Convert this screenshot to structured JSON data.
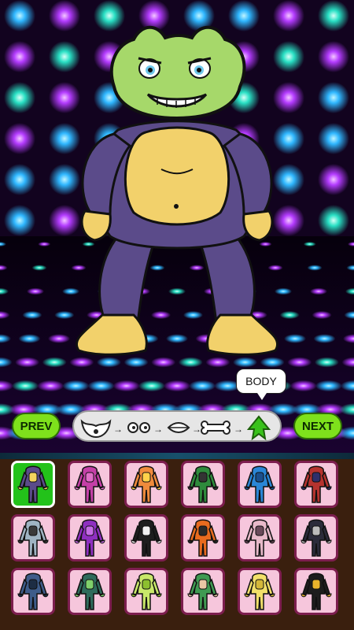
{
  "tooltip": {
    "label": "BODY"
  },
  "nav": {
    "prev_label": "PREV",
    "next_label": "NEXT"
  },
  "steps": [
    {
      "name": "head-shape-step-icon"
    },
    {
      "name": "eyes-step-icon"
    },
    {
      "name": "mouth-step-icon"
    },
    {
      "name": "bone-step-icon"
    },
    {
      "name": "body-step-icon",
      "active": true
    }
  ],
  "body_options": [
    {
      "name": "body-option-purple-muscle",
      "color": "#5b4b8a",
      "accent": "#f4d35e",
      "selected": true
    },
    {
      "name": "body-option-pink-suit",
      "color": "#c43fa7",
      "accent": "#e06fc8"
    },
    {
      "name": "body-option-orange-triangle",
      "color": "#f08b3c",
      "accent": "#ffd24a"
    },
    {
      "name": "body-option-fighter-green",
      "color": "#2e8b3c",
      "accent": "#333333"
    },
    {
      "name": "body-option-blue-hair",
      "color": "#2a86d6",
      "accent": "#1b4f8c"
    },
    {
      "name": "body-option-pirate-red",
      "color": "#b6332f",
      "accent": "#2f2f6b"
    },
    {
      "name": "body-option-gray-coat",
      "color": "#9fb4c3",
      "accent": "#3a3a3a"
    },
    {
      "name": "body-option-purple-long",
      "color": "#8e2fc0",
      "accent": "#c56be6"
    },
    {
      "name": "body-option-black-white",
      "color": "#1e1e1e",
      "accent": "#f0f0f0"
    },
    {
      "name": "body-option-orange-ninja",
      "color": "#e86b1f",
      "accent": "#2a2a2a"
    },
    {
      "name": "body-option-pink-dress",
      "color": "#e7b9c9",
      "accent": "#6a4a5a"
    },
    {
      "name": "body-option-dark-suit",
      "color": "#2b2b3a",
      "accent": "#bbbbbb"
    },
    {
      "name": "body-option-blue-coat",
      "color": "#3e5c8a",
      "accent": "#1d2d44"
    },
    {
      "name": "body-option-green-cape",
      "color": "#2e6b5b",
      "accent": "#7fd06b"
    },
    {
      "name": "body-option-yellow-green-hands",
      "color": "#c9e86a",
      "accent": "#8cbf2f"
    },
    {
      "name": "body-option-green-kimono",
      "color": "#3f9a52",
      "accent": "#e9c7a5"
    },
    {
      "name": "body-option-yellow-hands",
      "color": "#f2e06a",
      "accent": "#d4b83a"
    },
    {
      "name": "body-option-black-gold",
      "color": "#1d1d1d",
      "accent": "#e9b32b"
    }
  ]
}
